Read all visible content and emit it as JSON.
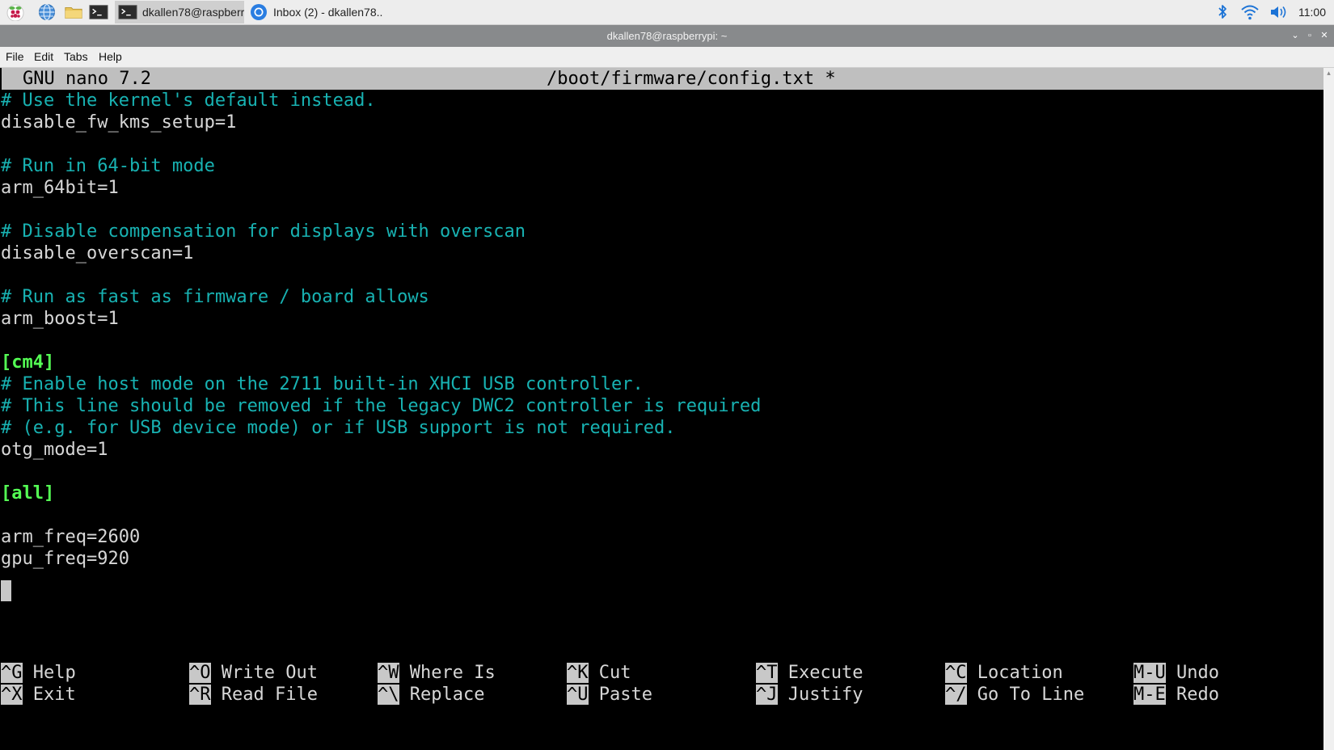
{
  "taskbar": {
    "windows": [
      {
        "label": "dkallen78@raspberr.."
      },
      {
        "label": "Inbox (2) - dkallen78.."
      }
    ],
    "clock": "11:00",
    "icons": [
      "raspberry-icon",
      "globe-icon",
      "folder-icon",
      "terminal-icon",
      "bluetooth-icon",
      "wifi-icon",
      "volume-icon"
    ]
  },
  "window": {
    "title": "dkallen78@raspberrypi: ~"
  },
  "menubar": {
    "items": [
      "File",
      "Edit",
      "Tabs",
      "Help"
    ]
  },
  "editor": {
    "app_version": "GNU nano 7.2",
    "filename": "/boot/firmware/config.txt *",
    "lines": [
      "# Use the kernel's default instead.",
      "disable_fw_kms_setup=1",
      "",
      "# Run in 64-bit mode",
      "arm_64bit=1",
      "",
      "# Disable compensation for displays with overscan",
      "disable_overscan=1",
      "",
      "# Run as fast as firmware / board allows",
      "arm_boost=1",
      "",
      "[cm4]",
      "# Enable host mode on the 2711 built-in XHCI USB controller.",
      "# This line should be removed if the legacy DWC2 controller is required",
      "# (e.g. for USB device mode) or if USB support is not required.",
      "otg_mode=1",
      "",
      "[all]",
      "",
      "arm_freq=2600",
      "gpu_freq=920"
    ]
  },
  "shortcuts": [
    {
      "key": "^G",
      "label": "Help"
    },
    {
      "key": "^O",
      "label": "Write Out"
    },
    {
      "key": "^W",
      "label": "Where Is"
    },
    {
      "key": "^K",
      "label": "Cut"
    },
    {
      "key": "^T",
      "label": "Execute"
    },
    {
      "key": "^C",
      "label": "Location"
    },
    {
      "key": "M-U",
      "label": "Undo"
    },
    {
      "key": "^X",
      "label": "Exit"
    },
    {
      "key": "^R",
      "label": "Read File"
    },
    {
      "key": "^\\",
      "label": "Replace"
    },
    {
      "key": "^U",
      "label": "Paste"
    },
    {
      "key": "^J",
      "label": "Justify"
    },
    {
      "key": "^/",
      "label": "Go To Line"
    },
    {
      "key": "M-E",
      "label": "Redo"
    }
  ],
  "colors": {
    "comment": "#18b2b2",
    "section": "#54ff54",
    "plain": "#d7d7d7",
    "background": "#000000"
  }
}
